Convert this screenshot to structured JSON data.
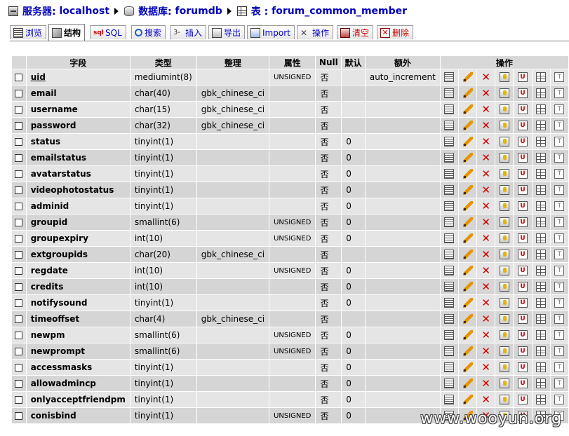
{
  "breadcrumb": {
    "server_label": "服务器:",
    "server": "localhost",
    "db_label": "数据库:",
    "db": "forumdb",
    "table_label": "表 :",
    "table": "forum_common_member"
  },
  "tabs": [
    {
      "label": "浏览",
      "icon": "browse-icon"
    },
    {
      "label": "结构",
      "icon": "structure-icon",
      "active": true
    },
    {
      "label": "SQL",
      "icon": "sql-icon"
    },
    {
      "label": "搜索",
      "icon": "search-icon"
    },
    {
      "label": "插入",
      "icon": "insert-icon"
    },
    {
      "label": "导出",
      "icon": "export-icon"
    },
    {
      "label": "Import",
      "icon": "import-icon"
    },
    {
      "label": "操作",
      "icon": "operations-icon"
    },
    {
      "label": "清空",
      "icon": "empty-icon",
      "danger": true
    },
    {
      "label": "删除",
      "icon": "drop-icon",
      "danger": true
    }
  ],
  "columns": {
    "field": "字段",
    "type": "类型",
    "collation": "整理",
    "attributes": "属性",
    "null": "Null",
    "default": "默认",
    "extra": "额外",
    "action": "操作"
  },
  "action_icons": [
    "browse-distinct-icon",
    "edit-icon",
    "drop-column-icon",
    "primary-key-icon",
    "unique-icon",
    "index-icon",
    "fulltext-icon"
  ],
  "rows": [
    {
      "field": "uid",
      "type": "mediumint(8)",
      "collation": "",
      "attributes": "UNSIGNED",
      "null": "否",
      "default": "",
      "extra": "auto_increment"
    },
    {
      "field": "email",
      "type": "char(40)",
      "collation": "gbk_chinese_ci",
      "attributes": "",
      "null": "否",
      "default": "",
      "extra": ""
    },
    {
      "field": "username",
      "type": "char(15)",
      "collation": "gbk_chinese_ci",
      "attributes": "",
      "null": "否",
      "default": "",
      "extra": ""
    },
    {
      "field": "password",
      "type": "char(32)",
      "collation": "gbk_chinese_ci",
      "attributes": "",
      "null": "否",
      "default": "",
      "extra": ""
    },
    {
      "field": "status",
      "type": "tinyint(1)",
      "collation": "",
      "attributes": "",
      "null": "否",
      "default": "0",
      "extra": ""
    },
    {
      "field": "emailstatus",
      "type": "tinyint(1)",
      "collation": "",
      "attributes": "",
      "null": "否",
      "default": "0",
      "extra": ""
    },
    {
      "field": "avatarstatus",
      "type": "tinyint(1)",
      "collation": "",
      "attributes": "",
      "null": "否",
      "default": "0",
      "extra": ""
    },
    {
      "field": "videophotostatus",
      "type": "tinyint(1)",
      "collation": "",
      "attributes": "",
      "null": "否",
      "default": "0",
      "extra": ""
    },
    {
      "field": "adminid",
      "type": "tinyint(1)",
      "collation": "",
      "attributes": "",
      "null": "否",
      "default": "0",
      "extra": ""
    },
    {
      "field": "groupid",
      "type": "smallint(6)",
      "collation": "",
      "attributes": "UNSIGNED",
      "null": "否",
      "default": "0",
      "extra": ""
    },
    {
      "field": "groupexpiry",
      "type": "int(10)",
      "collation": "",
      "attributes": "UNSIGNED",
      "null": "否",
      "default": "0",
      "extra": ""
    },
    {
      "field": "extgroupids",
      "type": "char(20)",
      "collation": "gbk_chinese_ci",
      "attributes": "",
      "null": "否",
      "default": "",
      "extra": ""
    },
    {
      "field": "regdate",
      "type": "int(10)",
      "collation": "",
      "attributes": "UNSIGNED",
      "null": "否",
      "default": "0",
      "extra": ""
    },
    {
      "field": "credits",
      "type": "int(10)",
      "collation": "",
      "attributes": "",
      "null": "否",
      "default": "0",
      "extra": ""
    },
    {
      "field": "notifysound",
      "type": "tinyint(1)",
      "collation": "",
      "attributes": "",
      "null": "否",
      "default": "0",
      "extra": ""
    },
    {
      "field": "timeoffset",
      "type": "char(4)",
      "collation": "gbk_chinese_ci",
      "attributes": "",
      "null": "否",
      "default": "",
      "extra": ""
    },
    {
      "field": "newpm",
      "type": "smallint(6)",
      "collation": "",
      "attributes": "UNSIGNED",
      "null": "否",
      "default": "0",
      "extra": ""
    },
    {
      "field": "newprompt",
      "type": "smallint(6)",
      "collation": "",
      "attributes": "UNSIGNED",
      "null": "否",
      "default": "0",
      "extra": ""
    },
    {
      "field": "accessmasks",
      "type": "tinyint(1)",
      "collation": "",
      "attributes": "",
      "null": "否",
      "default": "0",
      "extra": ""
    },
    {
      "field": "allowadmincp",
      "type": "tinyint(1)",
      "collation": "",
      "attributes": "",
      "null": "否",
      "default": "0",
      "extra": ""
    },
    {
      "field": "onlyacceptfriendpm",
      "type": "tinyint(1)",
      "collation": "",
      "attributes": "",
      "null": "否",
      "default": "0",
      "extra": ""
    },
    {
      "field": "conisbind",
      "type": "tinyint(1)",
      "collation": "",
      "attributes": "UNSIGNED",
      "null": "否",
      "default": "0",
      "extra": ""
    }
  ],
  "watermark": "www.wooyun.org"
}
